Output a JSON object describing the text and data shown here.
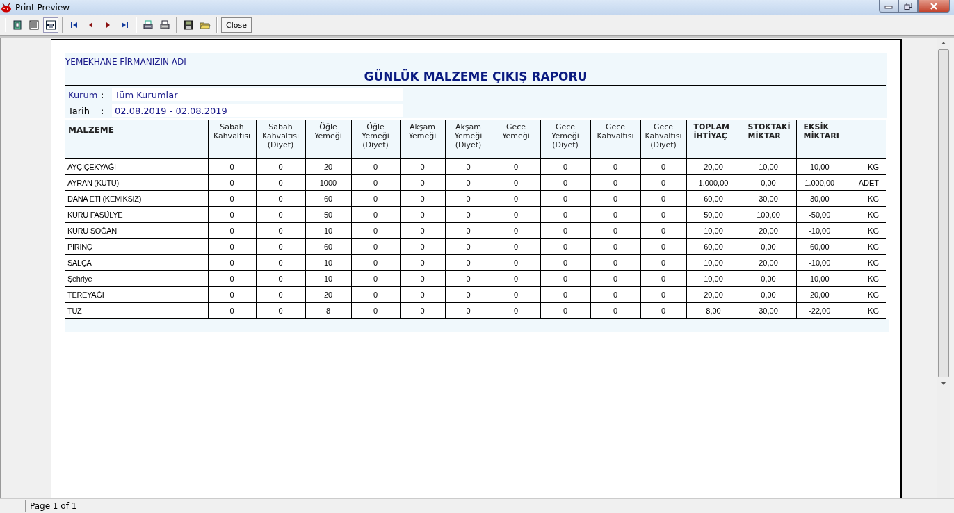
{
  "window": {
    "title": "Print Preview"
  },
  "toolbar": [
    {
      "kind": "page",
      "selected": false
    },
    {
      "kind": "lines",
      "selected": false
    },
    {
      "kind": "fit",
      "selected": true
    },
    {
      "kind": "sep"
    },
    {
      "kind": "first",
      "selected": false
    },
    {
      "kind": "prev",
      "selected": false
    },
    {
      "kind": "next",
      "selected": false
    },
    {
      "kind": "last",
      "selected": false
    },
    {
      "kind": "sep"
    },
    {
      "kind": "printsetup",
      "selected": false
    },
    {
      "kind": "print",
      "selected": false
    },
    {
      "kind": "sep"
    },
    {
      "kind": "save",
      "selected": false
    },
    {
      "kind": "open",
      "selected": false
    },
    {
      "kind": "sep"
    },
    {
      "kind": "close",
      "label": "Close"
    }
  ],
  "report": {
    "company": "YEMEKHANE FİRMANIZIN ADI",
    "title": "GÜNLÜK MALZEME ÇIKIŞ RAPORU",
    "filters": [
      {
        "label": "Kurum",
        "colon": ":",
        "value": "Tüm Kurumlar"
      },
      {
        "label": "Tarih",
        "colon": ":",
        "value": "02.08.2019 - 02.08.2019"
      }
    ],
    "columns": [
      {
        "kind": "name",
        "text": "MALZEME"
      },
      {
        "kind": "meal",
        "text": "Sabah Kahvaltısı"
      },
      {
        "kind": "meal",
        "text": "Sabah Kahvaltısı (Diyet)"
      },
      {
        "kind": "meal",
        "text": "Öğle Yemeği"
      },
      {
        "kind": "meal",
        "text": "Öğle Yemeği (Diyet)"
      },
      {
        "kind": "meal",
        "text": "Akşam Yemeği"
      },
      {
        "kind": "meal",
        "text": "Akşam Yemeği (Diyet)"
      },
      {
        "kind": "meal",
        "text": "Gece Yemeği"
      },
      {
        "kind": "meal",
        "text": "Gece Yemeği (Diyet)"
      },
      {
        "kind": "meal",
        "text": "Gece Kahvaltısı"
      },
      {
        "kind": "meal",
        "text": "Gece Kahvaltısı (Diyet)"
      },
      {
        "kind": "total",
        "text": "TOPLAM İHTİYAÇ"
      },
      {
        "kind": "total",
        "text": "STOKTAKİ MİKTAR"
      },
      {
        "kind": "total",
        "text": "EKSİK MİKTARI"
      }
    ],
    "rows": [
      {
        "name": "AYÇİÇEKYAĞI",
        "values": [
          "0",
          "0",
          "20",
          "0",
          "0",
          "0",
          "0",
          "0",
          "0",
          "0",
          "20,00",
          "10,00",
          "10,00"
        ],
        "unit": "KG"
      },
      {
        "name": "AYRAN (KUTU)",
        "values": [
          "0",
          "0",
          "1000",
          "0",
          "0",
          "0",
          "0",
          "0",
          "0",
          "0",
          "1.000,00",
          "0,00",
          "1.000,00"
        ],
        "unit": "ADET"
      },
      {
        "name": "DANA ETİ (KEMİKSİZ)",
        "values": [
          "0",
          "0",
          "60",
          "0",
          "0",
          "0",
          "0",
          "0",
          "0",
          "0",
          "60,00",
          "30,00",
          "30,00"
        ],
        "unit": "KG"
      },
      {
        "name": "KURU FASÜLYE",
        "values": [
          "0",
          "0",
          "50",
          "0",
          "0",
          "0",
          "0",
          "0",
          "0",
          "0",
          "50,00",
          "100,00",
          "-50,00"
        ],
        "unit": "KG"
      },
      {
        "name": "KURU SOĞAN",
        "values": [
          "0",
          "0",
          "10",
          "0",
          "0",
          "0",
          "0",
          "0",
          "0",
          "0",
          "10,00",
          "20,00",
          "-10,00"
        ],
        "unit": "KG"
      },
      {
        "name": "PİRİNÇ",
        "values": [
          "0",
          "0",
          "60",
          "0",
          "0",
          "0",
          "0",
          "0",
          "0",
          "0",
          "60,00",
          "0,00",
          "60,00"
        ],
        "unit": "KG"
      },
      {
        "name": "SALÇA",
        "values": [
          "0",
          "0",
          "10",
          "0",
          "0",
          "0",
          "0",
          "0",
          "0",
          "0",
          "10,00",
          "20,00",
          "-10,00"
        ],
        "unit": "KG"
      },
      {
        "name": "Şehriye",
        "values": [
          "0",
          "0",
          "10",
          "0",
          "0",
          "0",
          "0",
          "0",
          "0",
          "0",
          "10,00",
          "0,00",
          "10,00"
        ],
        "unit": "KG"
      },
      {
        "name": "TEREYAĞI",
        "values": [
          "0",
          "0",
          "20",
          "0",
          "0",
          "0",
          "0",
          "0",
          "0",
          "0",
          "20,00",
          "0,00",
          "20,00"
        ],
        "unit": "KG"
      },
      {
        "name": "TUZ",
        "values": [
          "0",
          "0",
          "8",
          "0",
          "0",
          "0",
          "0",
          "0",
          "0",
          "0",
          "8,00",
          "30,00",
          "-22,00"
        ],
        "unit": "KG"
      }
    ]
  },
  "status_bar": {
    "text": "Page 1 of 1"
  }
}
